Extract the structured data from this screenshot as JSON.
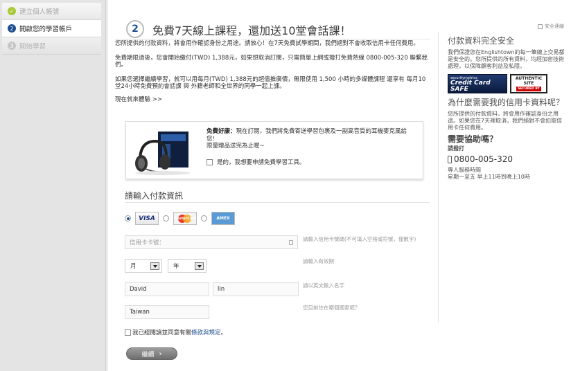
{
  "steps": [
    {
      "num": "✓",
      "label": "建立個人帳號"
    },
    {
      "num": "2",
      "label": "開啟您的學習帳戶"
    },
    {
      "num": "3",
      "label": "開始學習"
    }
  ],
  "header": {
    "step_number": "2",
    "headline": "免費7天線上課程，還加送10堂會話課！",
    "secure_link": "安全連線"
  },
  "intro": {
    "p1": "您所提供的付款資料，將會用作確認身份之用途。請放心！在7天免費試學期間，我們絕對不會收取信用卡任何費用。",
    "p2": "免費期限過後，您會開始繳付(TWD) 1,388元，如果想取消訂閱，只需簡單上網或撥打免費熱線 0800-005-320 聯繫我們。",
    "p3": "如果您選擇繼續學習，就可以用每月(TWD) 1,388元的超值推廣價，無限使用 1,500 小時的多媒體課程 還享有 每月10堂24小時免費預約會話課 與 外籍老師和全世界的同學一起上課。",
    "more_link": "現在就來體驗 >>"
  },
  "promo": {
    "title": "免費好康：",
    "text": "現在訂閱，我們將免費寄送學習包裹及一副高音質的耳機麥克風給您！",
    "note": "限量贈品送完為止喔~",
    "checkbox_label": "是的，我想要申請免費學習工具。"
  },
  "payment": {
    "title": "請輸入付款資訊",
    "cards": {
      "visa": "VISA",
      "mastercard": "MasterCard",
      "amex": "AMEX"
    },
    "card_number_placeholder": "信用卡卡號：",
    "card_hint": "請輸入信用卡號碼(不可填入空格或符號，僅數字)",
    "month_label": "月",
    "year_label": "年",
    "expiry_hint": "請輸入有效期",
    "first_name": "David",
    "last_name": "lin",
    "name_hint": "請以英文輸入名字",
    "country": "Taiwan",
    "country_hint": "您目前住在哪個國家呢？",
    "agree_prefix": "我已經閱讀並同意有關",
    "agree_link": "條款與規定",
    "agree_suffix": "。",
    "continue_label": "繼續"
  },
  "aside": {
    "secure_title": "付款資料完全安全",
    "secure_text": "我們保證您在Englishtown的每一筆線上交易都是安全的。您所提供的所有資料，均經加密技術處理，以保障顧客利益及私隱。",
    "seal1_small": "securitymetrics",
    "seal1_big": "Credit Card SAFE",
    "seal2_line1": "AUTHENTIC",
    "seal2_line2": "SITE",
    "seal2_sub": "SECURED BY",
    "why_title": "為什麼需要我的信用卡資料呢？",
    "why_text": "您所提供的付款資料，將會用作確認身份之用途。如果您在7天裡取消，我們絕對不會扣取信用卡任何費用。",
    "help_title": "需要協助嗎？",
    "call_label": "請撥打",
    "phone": "0800-005-320",
    "hours_label": "專人服務時間",
    "hours": "星期一至五 早上11時到晚上10時"
  }
}
